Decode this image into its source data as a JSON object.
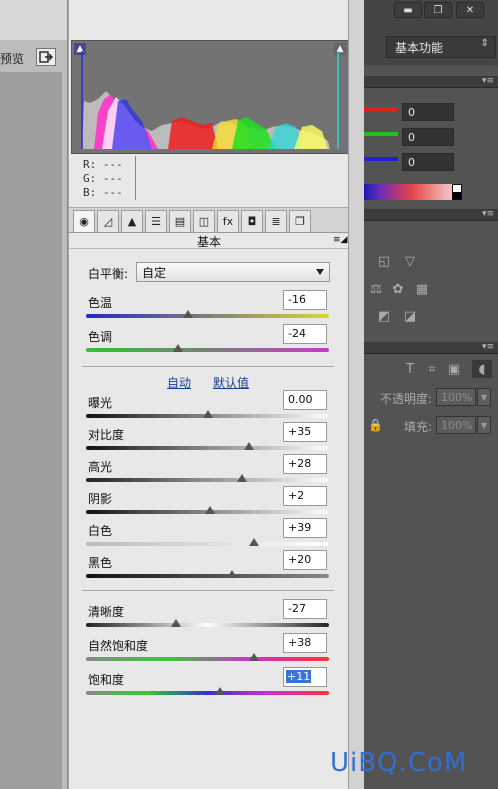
{
  "preview": {
    "label": "预览"
  },
  "rgb_readout": {
    "r": "R:  ---",
    "g": "G:  ---",
    "b": "B:  ---"
  },
  "panel": {
    "title": "基本"
  },
  "tabs": [
    "basic-icon",
    "tone-curve-icon",
    "detail-icon",
    "hsl-icon",
    "split-toning-icon",
    "lens-icon",
    "fx-icon",
    "camera-calibration-icon",
    "presets-icon",
    "snapshots-icon"
  ],
  "white_balance": {
    "label": "白平衡:",
    "value": "自定"
  },
  "sliders_wb": [
    {
      "label": "色温",
      "value": "-16",
      "level": 0.42
    },
    {
      "label": "色调",
      "value": "-24",
      "level": 0.38
    }
  ],
  "tone_links": {
    "auto": "自动",
    "default": "默认值"
  },
  "sliders_tone": [
    {
      "label": "曝光",
      "value": "0.00",
      "level": 0.5
    },
    {
      "label": "对比度",
      "value": "+35",
      "level": 0.67
    },
    {
      "label": "高光",
      "value": "+28",
      "level": 0.64
    },
    {
      "label": "阴影",
      "value": "+2",
      "level": 0.51
    },
    {
      "label": "白色",
      "value": "+39",
      "level": 0.69
    },
    {
      "label": "黑色",
      "value": "+20",
      "level": 0.6
    }
  ],
  "sliders_presence": [
    {
      "label": "清晰度",
      "value": "-27",
      "level": 0.37
    },
    {
      "label": "自然饱和度",
      "value": "+38",
      "level": 0.69
    },
    {
      "label": "饱和度",
      "value": "+11",
      "level": 0.55
    }
  ],
  "photoshop": {
    "window": {
      "minimize": "▬",
      "maximize": "❐",
      "close": "✕"
    },
    "workspace": "基本功能",
    "color_values": [
      "0",
      "0",
      "0"
    ],
    "layers": {
      "opacity_label": "不透明度:",
      "opacity_value": "100%",
      "fill_label": "填充:",
      "fill_value": "100%"
    }
  },
  "watermark": "UiBQ.CoM"
}
